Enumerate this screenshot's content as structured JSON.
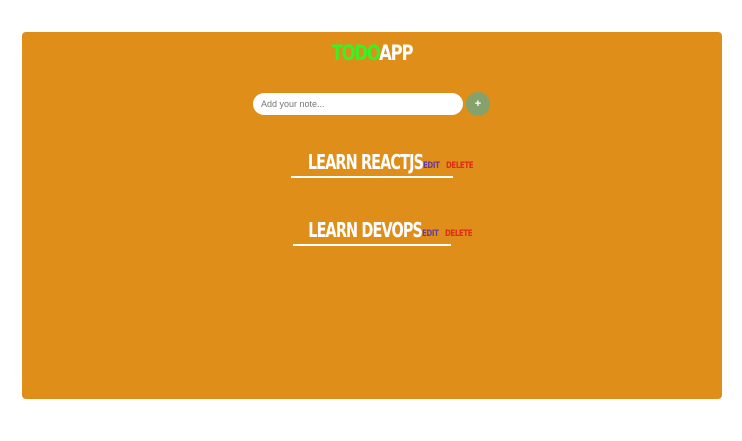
{
  "app": {
    "title_part1": "TODO",
    "title_part2": "APP",
    "title_part1_color": "#3cf028",
    "title_part2_color": "#ffffff",
    "background_color": "#df8e1a"
  },
  "input": {
    "placeholder": "Add your note...",
    "value": "",
    "add_button_label": "+",
    "add_button_color": "#86a26c"
  },
  "todos": [
    {
      "text": "LEARN REACTJS",
      "edit_label": "EDIT",
      "delete_label": "DELETE"
    },
    {
      "text": "LEARN DEVOPS",
      "edit_label": "EDIT",
      "delete_label": "DELETE"
    }
  ],
  "colors": {
    "edit": "#6a3b9c",
    "delete": "#e02a14"
  }
}
